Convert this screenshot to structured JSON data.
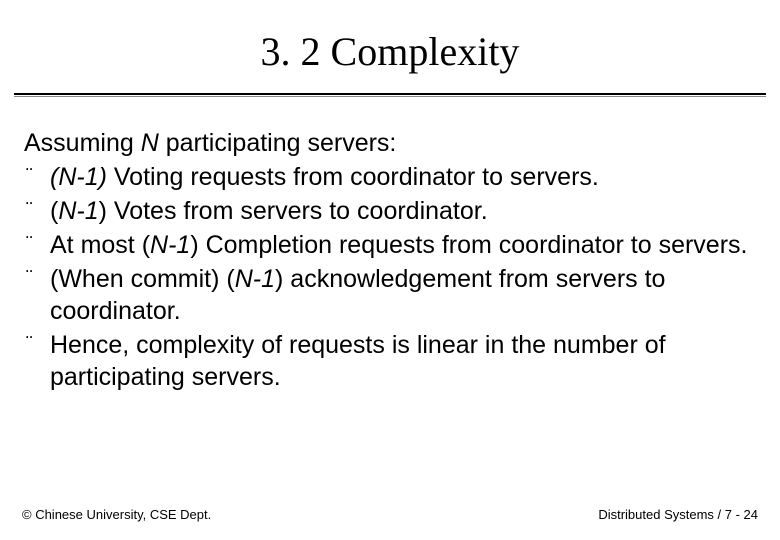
{
  "title": "3. 2 Complexity",
  "intro_pre": "Assuming ",
  "intro_em": "N",
  "intro_post": " participating servers:",
  "bullets": [
    {
      "em1": "(N-1) ",
      "t1": "Voting requests from coordinator to servers."
    },
    {
      "t0": "(",
      "em1": "N-1",
      "t1": ") Votes from servers to coordinator."
    },
    {
      "t0": "At most ",
      "em1": "",
      "mid": "(",
      "em2": "N-1",
      "t1": ") Completion requests from coordinator to servers."
    },
    {
      "t0": "(When commit) (",
      "em1": "N-1",
      "t1": ") acknowledgement from servers to coordinator."
    },
    {
      "t0": "Hence, complexity of requests is linear in the number of participating servers.",
      "em1": "",
      "t1": ""
    }
  ],
  "bullet_glyph": "¨",
  "footer_left": "© Chinese University, CSE Dept.",
  "footer_right": "Distributed Systems / 7 - 24"
}
